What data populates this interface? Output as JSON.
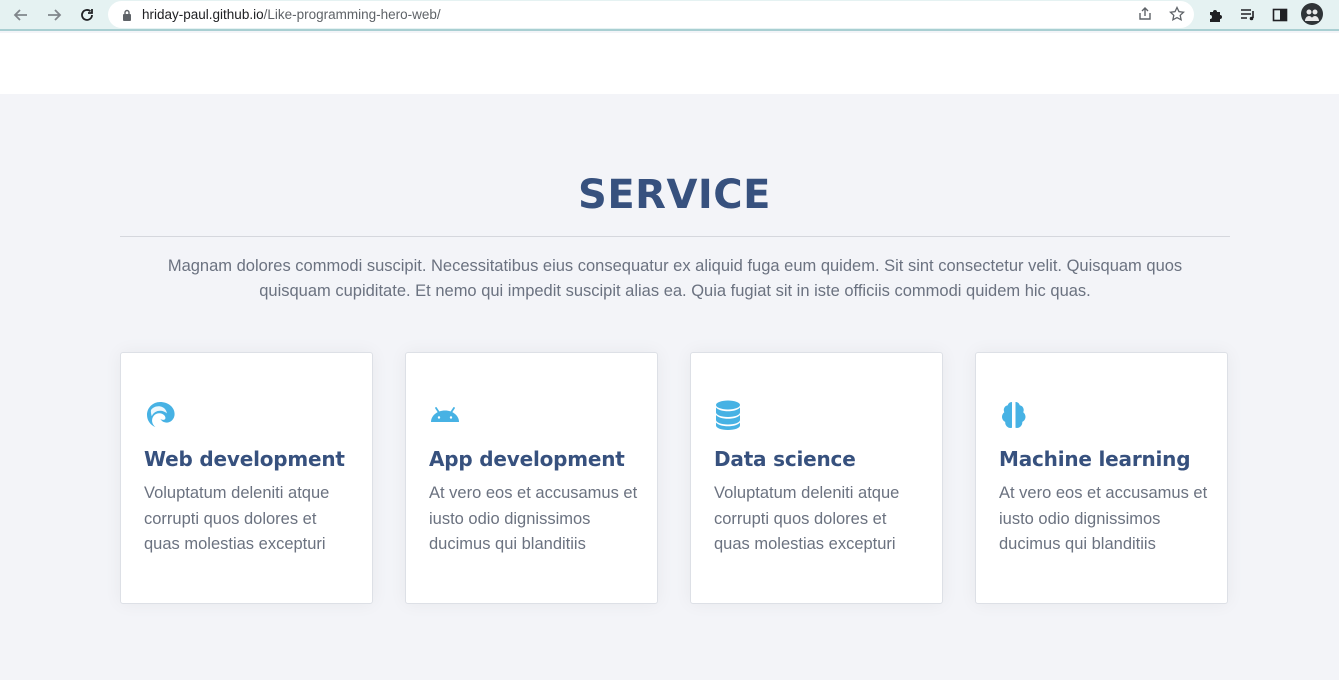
{
  "browser": {
    "url_host": "hriday-paul.github.io",
    "url_path": "/Like-programming-hero-web/"
  },
  "section": {
    "title": "SERVICE",
    "intro": "Magnam dolores commodi suscipit. Necessitatibus eius consequatur ex aliquid fuga eum quidem. Sit sint consectetur velit. Quisquam quos quisquam cupiditate. Et nemo qui impedit suscipit alias ea. Quia fugiat sit in iste officiis commodi quidem hic quas."
  },
  "services": [
    {
      "icon": "edge-browser-icon",
      "title": "Web development",
      "text": "Voluptatum deleniti atque corrupti quos dolores et quas molestias excepturi"
    },
    {
      "icon": "android-icon",
      "title": "App development",
      "text": "At vero eos et accusamus et iusto odio dignissimos ducimus qui blanditiis"
    },
    {
      "icon": "database-icon",
      "title": "Data science",
      "text": "Voluptatum deleniti atque corrupti quos dolores et quas molestias excepturi"
    },
    {
      "icon": "brain-icon",
      "title": "Machine learning",
      "text": "At vero eos et accusamus et iusto odio dignissimos ducimus qui blanditiis"
    }
  ],
  "colors": {
    "accent": "#47b2e4",
    "heading": "#37517e",
    "text": "#6b7280",
    "background": "#f3f4f8"
  }
}
